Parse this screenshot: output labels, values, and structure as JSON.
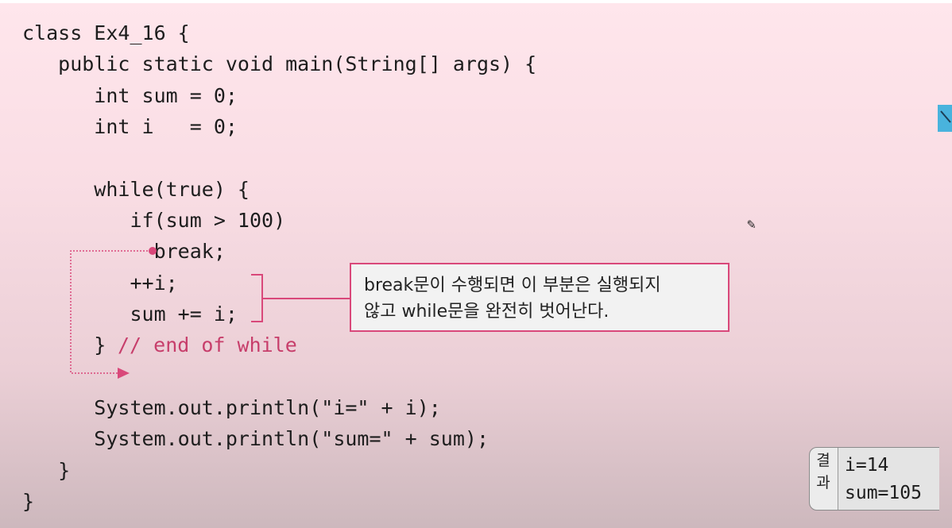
{
  "code": {
    "lines": [
      "class Ex4_16 {",
      "   public static void main(String[] args) {",
      "      int sum = 0;",
      "      int i   = 0;",
      "",
      "      while(true) {",
      "         if(sum > 100)",
      "           break;",
      "         ++i;",
      "         sum += i;",
      "      } ",
      "",
      "      System.out.println(\"i=\" + i);",
      "      System.out.println(\"sum=\" + sum);",
      "   }",
      "}"
    ],
    "comment": "// end of while"
  },
  "callout": {
    "line1": "break문이 수행되면 이 부분은 실행되지",
    "line2": "않고 while문을 완전히 벗어난다."
  },
  "result": {
    "label_top": "결",
    "label_bottom": "과",
    "output_line1": "i=14",
    "output_line2": "sum=105"
  },
  "icons": {
    "pencil": "pencil-icon",
    "side_tab": "edit-tab-icon"
  },
  "colors": {
    "accent": "#d9487a",
    "comment": "#c73e6b",
    "side_tab": "#49b3dd"
  }
}
